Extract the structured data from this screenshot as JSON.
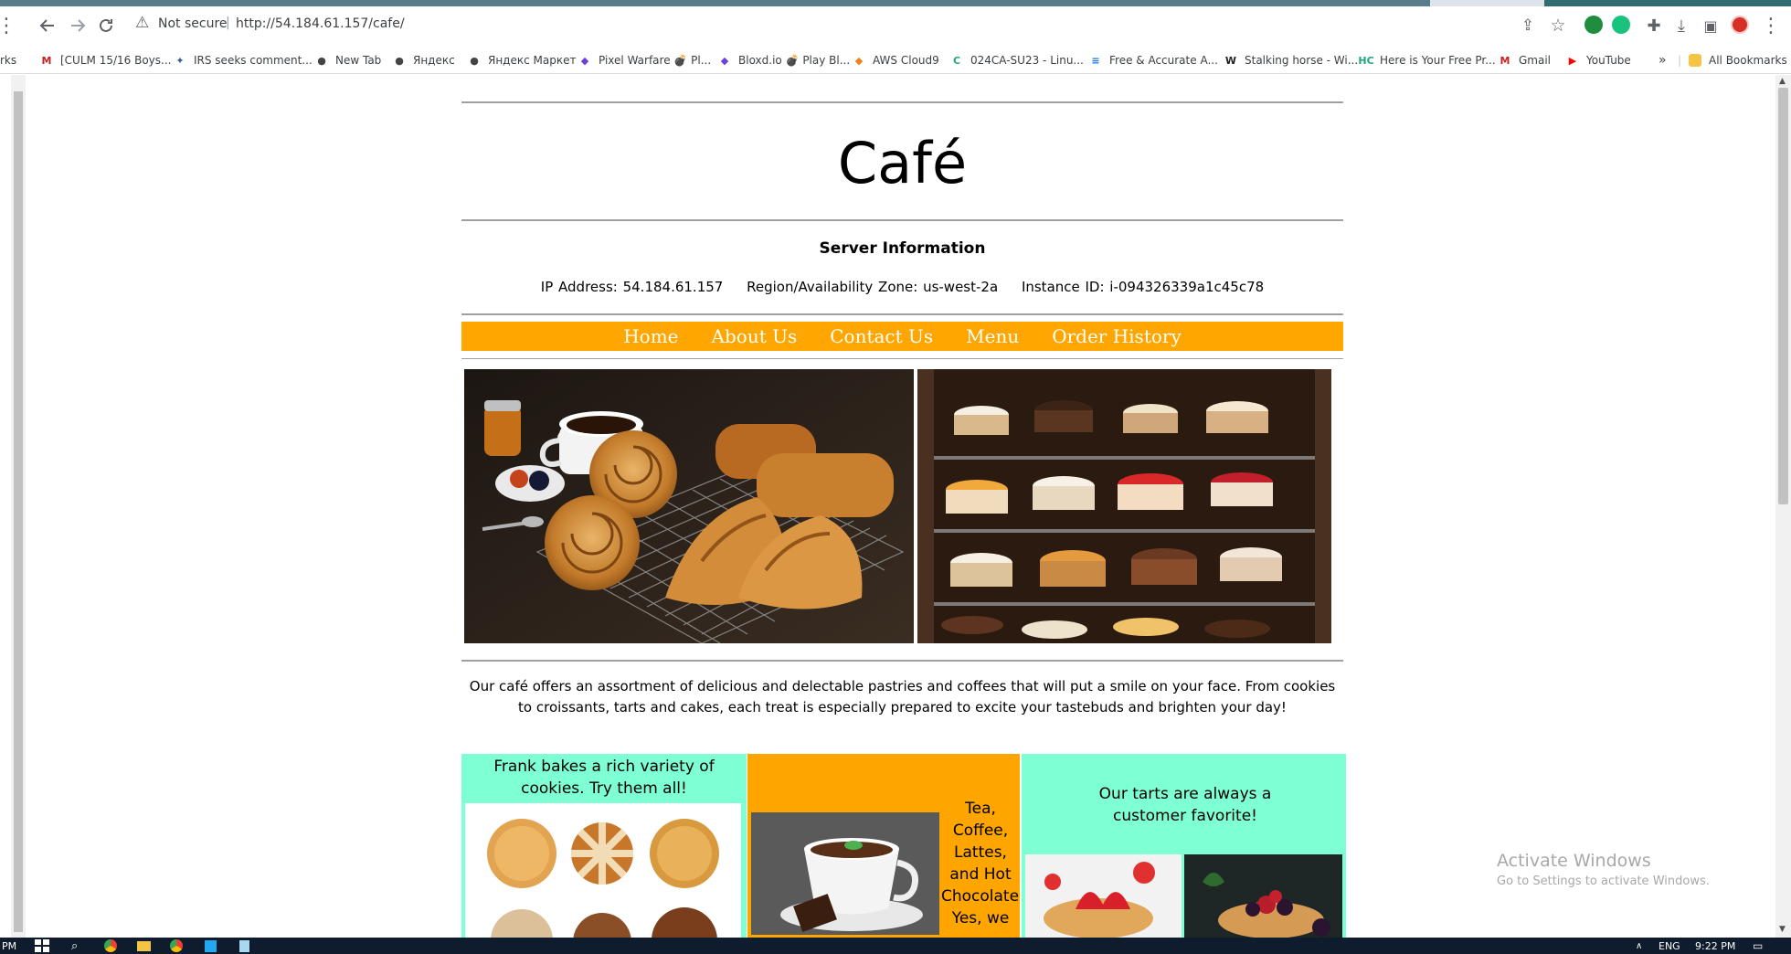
{
  "browser": {
    "left_edge_menu": "⋮",
    "security_label": "Not secure",
    "url": "http://54.184.61.157/cafe/",
    "bookmarks_left_edge": "rks",
    "bookmarks": [
      {
        "label": "[CULM 15/16 Boys...",
        "icon": "gmail-icon",
        "color": "#c5221f",
        "glyph": "M"
      },
      {
        "label": "IRS seeks comment...",
        "icon": "irs-icon",
        "color": "#3b5b8c",
        "glyph": "✦"
      },
      {
        "label": "New Tab",
        "icon": "globe-icon",
        "color": "#444444",
        "glyph": "●"
      },
      {
        "label": "Яндекс",
        "icon": "globe-icon",
        "color": "#444444",
        "glyph": "●"
      },
      {
        "label": "Яндекс Маркет",
        "icon": "globe-icon",
        "color": "#444444",
        "glyph": "●"
      },
      {
        "label": "Pixel Warfare 💣 Pl...",
        "icon": "shield-icon",
        "color": "#6741d9",
        "glyph": "◆"
      },
      {
        "label": "Bloxd.io 💣 Play Bl...",
        "icon": "shield-icon",
        "color": "#6741d9",
        "glyph": "◆"
      },
      {
        "label": "AWS Cloud9",
        "icon": "cloud9-icon",
        "color": "#f0811a",
        "glyph": "◆"
      },
      {
        "label": "024CA-SU23 - Linu...",
        "icon": "canvas-icon",
        "color": "#1fa67a",
        "glyph": "C"
      },
      {
        "label": "Free & Accurate A...",
        "icon": "doc-icon",
        "color": "#1a73e8",
        "glyph": "≡"
      },
      {
        "label": "Stalking horse - Wi...",
        "icon": "wikipedia-icon",
        "color": "#222222",
        "glyph": "W"
      },
      {
        "label": "Here is Your Free Pr...",
        "icon": "hc-icon",
        "color": "#1fa67a",
        "glyph": "HC"
      },
      {
        "label": "Gmail",
        "icon": "gmail-icon",
        "color": "#c5221f",
        "glyph": "M"
      },
      {
        "label": "YouTube",
        "icon": "youtube-icon",
        "color": "#ff0000",
        "glyph": "▶"
      }
    ],
    "more_bookmarks": "»",
    "all_bookmarks": "All Bookmarks"
  },
  "site": {
    "title": "Café",
    "server_heading": "Server Information",
    "server_info": {
      "ip": "IP Address: 54.184.61.157",
      "region": "Region/Availability Zone: us-west-2a",
      "instance": "Instance ID: i-094326339a1c45c78"
    },
    "nav": [
      "Home",
      "About Us",
      "Contact Us",
      "Menu",
      "Order History"
    ],
    "blurb": "Our café offers an assortment of delicious and delectable pastries and coffees that will put a smile on your face. From cookies to croissants, tarts and cakes, each treat is especially prepared to excite your tastebuds and brighten your day!",
    "panels": {
      "cookies": "Frank bakes a rich variety of cookies. Try them all!",
      "drinks": "Tea, Coffee, Lattes, and Hot Chocolate. Yes, we",
      "tarts": "Our tarts are always a customer favorite!"
    }
  },
  "watermark": {
    "title": "Activate Windows",
    "subtitle": "Go to Settings to activate Windows."
  },
  "taskbar": {
    "left_text": "PM",
    "lang": "ENG",
    "time": "9:22 PM"
  },
  "colors": {
    "nav_bg": "#ffa600",
    "panel_aqua": "#7fffd4",
    "panel_orange": "#ffa500"
  }
}
